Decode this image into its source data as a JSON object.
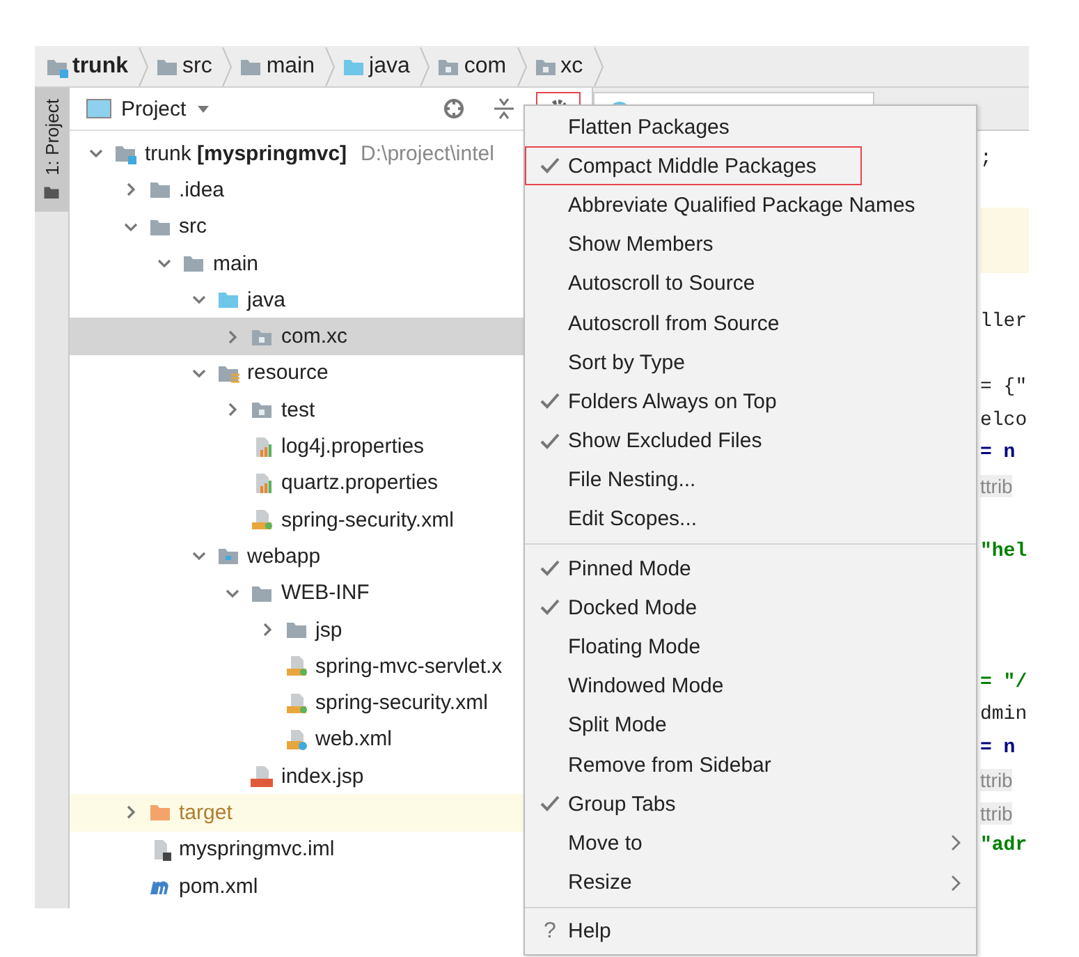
{
  "breadcrumbs": [
    {
      "label": "trunk",
      "kind": "module",
      "bold": true
    },
    {
      "label": "src",
      "kind": "folder",
      "bold": false
    },
    {
      "label": "main",
      "kind": "folder",
      "bold": false
    },
    {
      "label": "java",
      "kind": "source",
      "bold": false
    },
    {
      "label": "com",
      "kind": "package",
      "bold": false
    },
    {
      "label": "xc",
      "kind": "package",
      "bold": false
    }
  ],
  "side_strip": {
    "label": "1: Project"
  },
  "project_panel": {
    "title": "Project",
    "tools": [
      {
        "kind": "locate",
        "outlined": false
      },
      {
        "kind": "collapse",
        "outlined": false
      },
      {
        "kind": "gear",
        "outlined": true
      }
    ],
    "tree": [
      {
        "name": "trunk **[myspringmvc]**",
        "path": "D:\\project\\intel",
        "kind": "module",
        "expanded": true,
        "selected": false,
        "children": [
          {
            "name": ".idea",
            "kind": "folder",
            "expanded": false,
            "selected": false
          },
          {
            "name": "src",
            "kind": "folder",
            "expanded": true,
            "selected": false,
            "children": [
              {
                "name": "main",
                "kind": "folder",
                "expanded": true,
                "selected": false,
                "children": [
                  {
                    "name": "java",
                    "kind": "source",
                    "expanded": true,
                    "selected": false,
                    "children": [
                      {
                        "name": "com.xc",
                        "kind": "package",
                        "expanded": false,
                        "selected": true
                      }
                    ]
                  },
                  {
                    "name": "resource",
                    "kind": "resource",
                    "expanded": true,
                    "selected": false,
                    "children": [
                      {
                        "name": "test",
                        "kind": "package",
                        "expanded": false,
                        "selected": false
                      },
                      {
                        "name": "log4j.properties",
                        "kind": "properties",
                        "selected": false
                      },
                      {
                        "name": "quartz.properties",
                        "kind": "properties",
                        "selected": false
                      },
                      {
                        "name": "spring-security.xml",
                        "kind": "spring-xml",
                        "selected": false
                      }
                    ]
                  },
                  {
                    "name": "webapp",
                    "kind": "web",
                    "expanded": true,
                    "selected": false,
                    "children": [
                      {
                        "name": "WEB-INF",
                        "kind": "folder",
                        "expanded": true,
                        "selected": false,
                        "children": [
                          {
                            "name": "jsp",
                            "kind": "folder",
                            "expanded": false,
                            "selected": false
                          },
                          {
                            "name": "spring-mvc-servlet.x",
                            "kind": "spring-xml",
                            "selected": false
                          },
                          {
                            "name": "spring-security.xml",
                            "kind": "spring-xml",
                            "selected": false
                          },
                          {
                            "name": "web.xml",
                            "kind": "web-xml",
                            "selected": false
                          }
                        ]
                      },
                      {
                        "name": "index.jsp",
                        "kind": "jsp",
                        "selected": false
                      }
                    ]
                  }
                ]
              }
            ]
          },
          {
            "name": "target",
            "kind": "excluded",
            "expanded": false,
            "selected": false,
            "excluded": true
          },
          {
            "name": "myspringmvc.iml",
            "kind": "iml",
            "selected": false
          },
          {
            "name": "pom.xml",
            "kind": "maven",
            "selected": false
          }
        ]
      }
    ]
  },
  "editor": {
    "lines": [
      {
        "kind": "code",
        "text": ";"
      },
      {
        "kind": "blank"
      },
      {
        "kind": "highlight"
      },
      {
        "kind": "highlight"
      },
      {
        "kind": "blank"
      },
      {
        "kind": "code",
        "text": "ller"
      },
      {
        "kind": "blank"
      },
      {
        "kind": "code",
        "text": "= {\""
      },
      {
        "kind": "code",
        "text": "elco"
      },
      {
        "kind": "keyword",
        "text": "= n"
      },
      {
        "kind": "hint",
        "text": "ttrib"
      },
      {
        "kind": "blank"
      },
      {
        "kind": "string",
        "text": "\"hel"
      },
      {
        "kind": "blank"
      },
      {
        "kind": "blank"
      },
      {
        "kind": "blank"
      },
      {
        "kind": "string",
        "text": "= \"/"
      },
      {
        "kind": "code",
        "text": "dmin"
      },
      {
        "kind": "keyword",
        "text": "= n"
      },
      {
        "kind": "hint",
        "text": "ttrib"
      },
      {
        "kind": "hint",
        "text": "ttrib"
      },
      {
        "kind": "string",
        "text": "\"adr"
      }
    ]
  },
  "menu": {
    "groups": [
      [
        {
          "label": "Flatten Packages",
          "checked": false,
          "outlined": false,
          "submenu": false
        },
        {
          "label": "Compact Middle Packages",
          "checked": true,
          "outlined": true,
          "submenu": false
        },
        {
          "label": "Abbreviate Qualified Package Names",
          "checked": false,
          "outlined": false,
          "submenu": false
        },
        {
          "label": "Show Members",
          "checked": false,
          "outlined": false,
          "submenu": false
        },
        {
          "label": "Autoscroll to Source",
          "checked": false,
          "outlined": false,
          "submenu": false
        },
        {
          "label": "Autoscroll from Source",
          "checked": false,
          "outlined": false,
          "submenu": false
        },
        {
          "label": "Sort by Type",
          "checked": false,
          "outlined": false,
          "submenu": false
        },
        {
          "label": "Folders Always on Top",
          "checked": true,
          "outlined": false,
          "submenu": false
        },
        {
          "label": "Show Excluded Files",
          "checked": true,
          "outlined": false,
          "submenu": false
        },
        {
          "label": "File Nesting...",
          "checked": false,
          "outlined": false,
          "submenu": false
        },
        {
          "label": "Edit Scopes...",
          "checked": false,
          "outlined": false,
          "submenu": false
        }
      ],
      [
        {
          "label": "Pinned Mode",
          "checked": true,
          "outlined": false,
          "submenu": false
        },
        {
          "label": "Docked Mode",
          "checked": true,
          "outlined": false,
          "submenu": false
        },
        {
          "label": "Floating Mode",
          "checked": false,
          "outlined": false,
          "submenu": false
        },
        {
          "label": "Windowed Mode",
          "checked": false,
          "outlined": false,
          "submenu": false
        },
        {
          "label": "Split Mode",
          "checked": false,
          "outlined": false,
          "submenu": false
        },
        {
          "label": "Remove from Sidebar",
          "checked": false,
          "outlined": false,
          "submenu": false
        },
        {
          "label": "Group Tabs",
          "checked": true,
          "outlined": false,
          "submenu": false
        },
        {
          "label": "Move to",
          "checked": false,
          "outlined": false,
          "submenu": true
        },
        {
          "label": "Resize",
          "checked": false,
          "outlined": false,
          "submenu": true
        }
      ],
      [
        {
          "label": "Help",
          "icon": "?",
          "checked": false,
          "outlined": false,
          "submenu": false
        }
      ]
    ]
  }
}
